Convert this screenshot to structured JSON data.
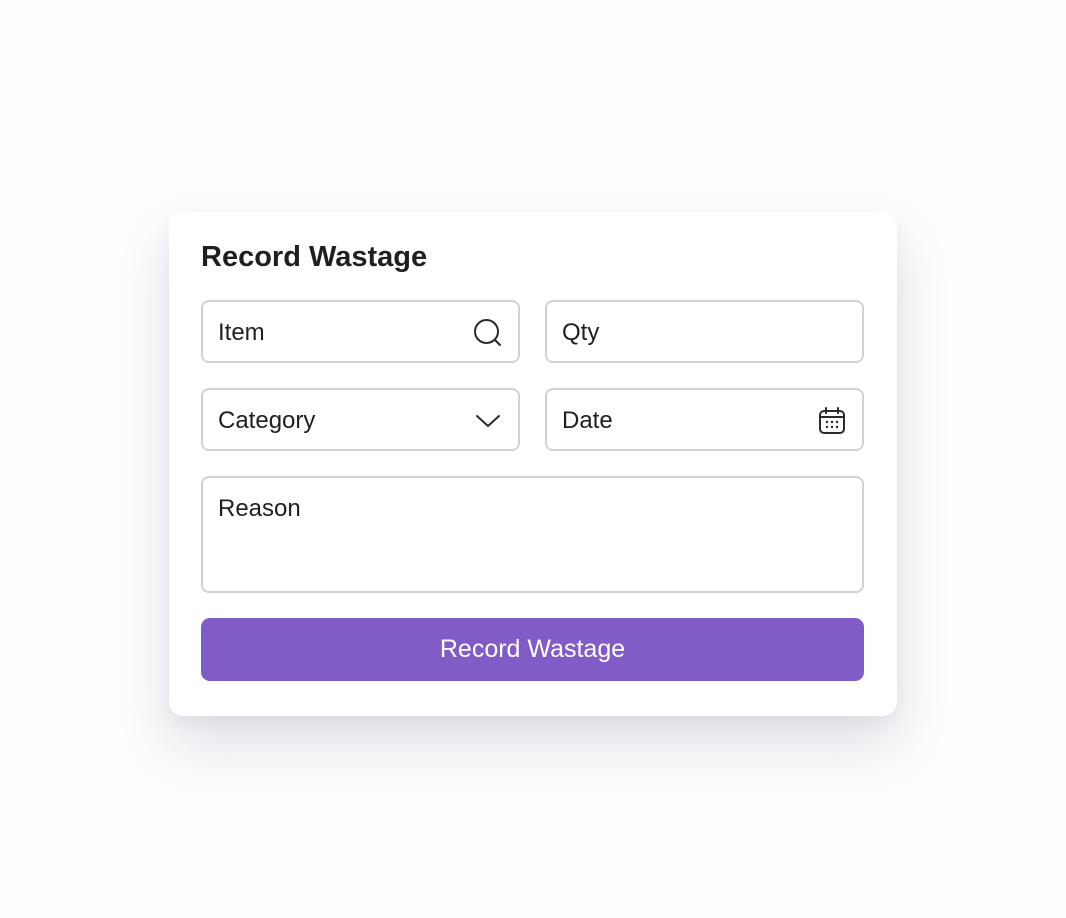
{
  "form": {
    "title": "Record Wastage",
    "item": {
      "placeholder": "Item",
      "icon": "search-icon"
    },
    "qty": {
      "placeholder": "Qty"
    },
    "category": {
      "placeholder": "Category",
      "icon": "chevron-down-icon"
    },
    "date": {
      "placeholder": "Date",
      "icon": "calendar-icon"
    },
    "reason": {
      "placeholder": "Reason"
    },
    "submit_label": "Record Wastage"
  },
  "colors": {
    "accent": "#815cc6",
    "field_border": "#d2d2d6",
    "text": "#1f1f1f",
    "page_background": "#fdfcfe"
  }
}
